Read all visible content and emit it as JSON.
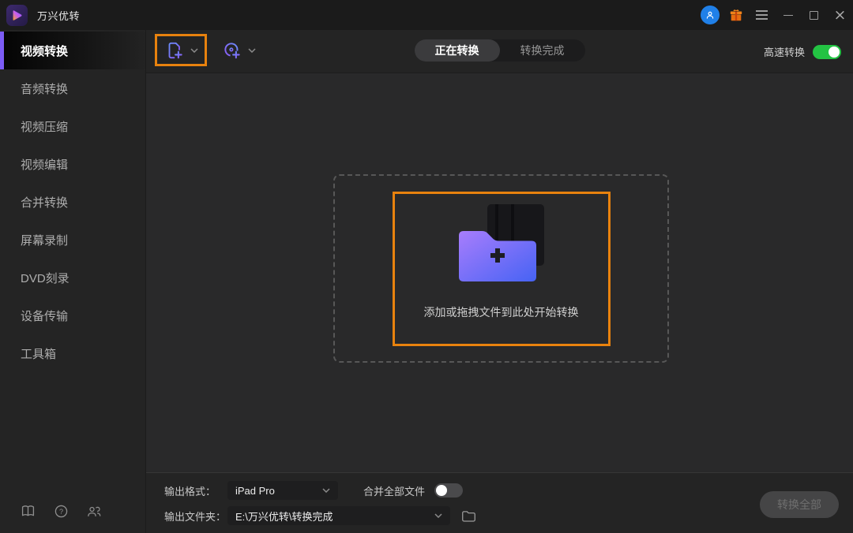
{
  "window": {
    "title": "万兴优转"
  },
  "sidebar": {
    "items": [
      {
        "label": "视频转换",
        "active": true
      },
      {
        "label": "音频转换",
        "active": false
      },
      {
        "label": "视频压缩",
        "active": false
      },
      {
        "label": "视频编辑",
        "active": false
      },
      {
        "label": "合并转换",
        "active": false
      },
      {
        "label": "屏幕录制",
        "active": false
      },
      {
        "label": "DVD刻录",
        "active": false
      },
      {
        "label": "设备传输",
        "active": false
      },
      {
        "label": "工具箱",
        "active": false
      }
    ]
  },
  "toolbar": {
    "tabs": [
      {
        "label": "正在转换",
        "active": true
      },
      {
        "label": "转换完成",
        "active": false
      }
    ],
    "highspeed": {
      "label": "高速转换",
      "on": true
    }
  },
  "dropzone": {
    "hint": "添加或拖拽文件到此处开始转换"
  },
  "bottom": {
    "format_label": "输出格式：",
    "format_value": "iPad Pro",
    "merge_label": "合并全部文件",
    "merge_on": false,
    "folder_label": "输出文件夹：",
    "folder_value": "E:\\万兴优转\\转换完成",
    "convert_all_label": "转换全部"
  },
  "colors": {
    "highlight_orange": "#E8820E",
    "accent_purple": "#7C5CF6",
    "toggle_green": "#23C343",
    "avatar_blue": "#2080E8",
    "folder_gradient_start": "#A87DFC",
    "folder_gradient_end": "#4663F4"
  }
}
